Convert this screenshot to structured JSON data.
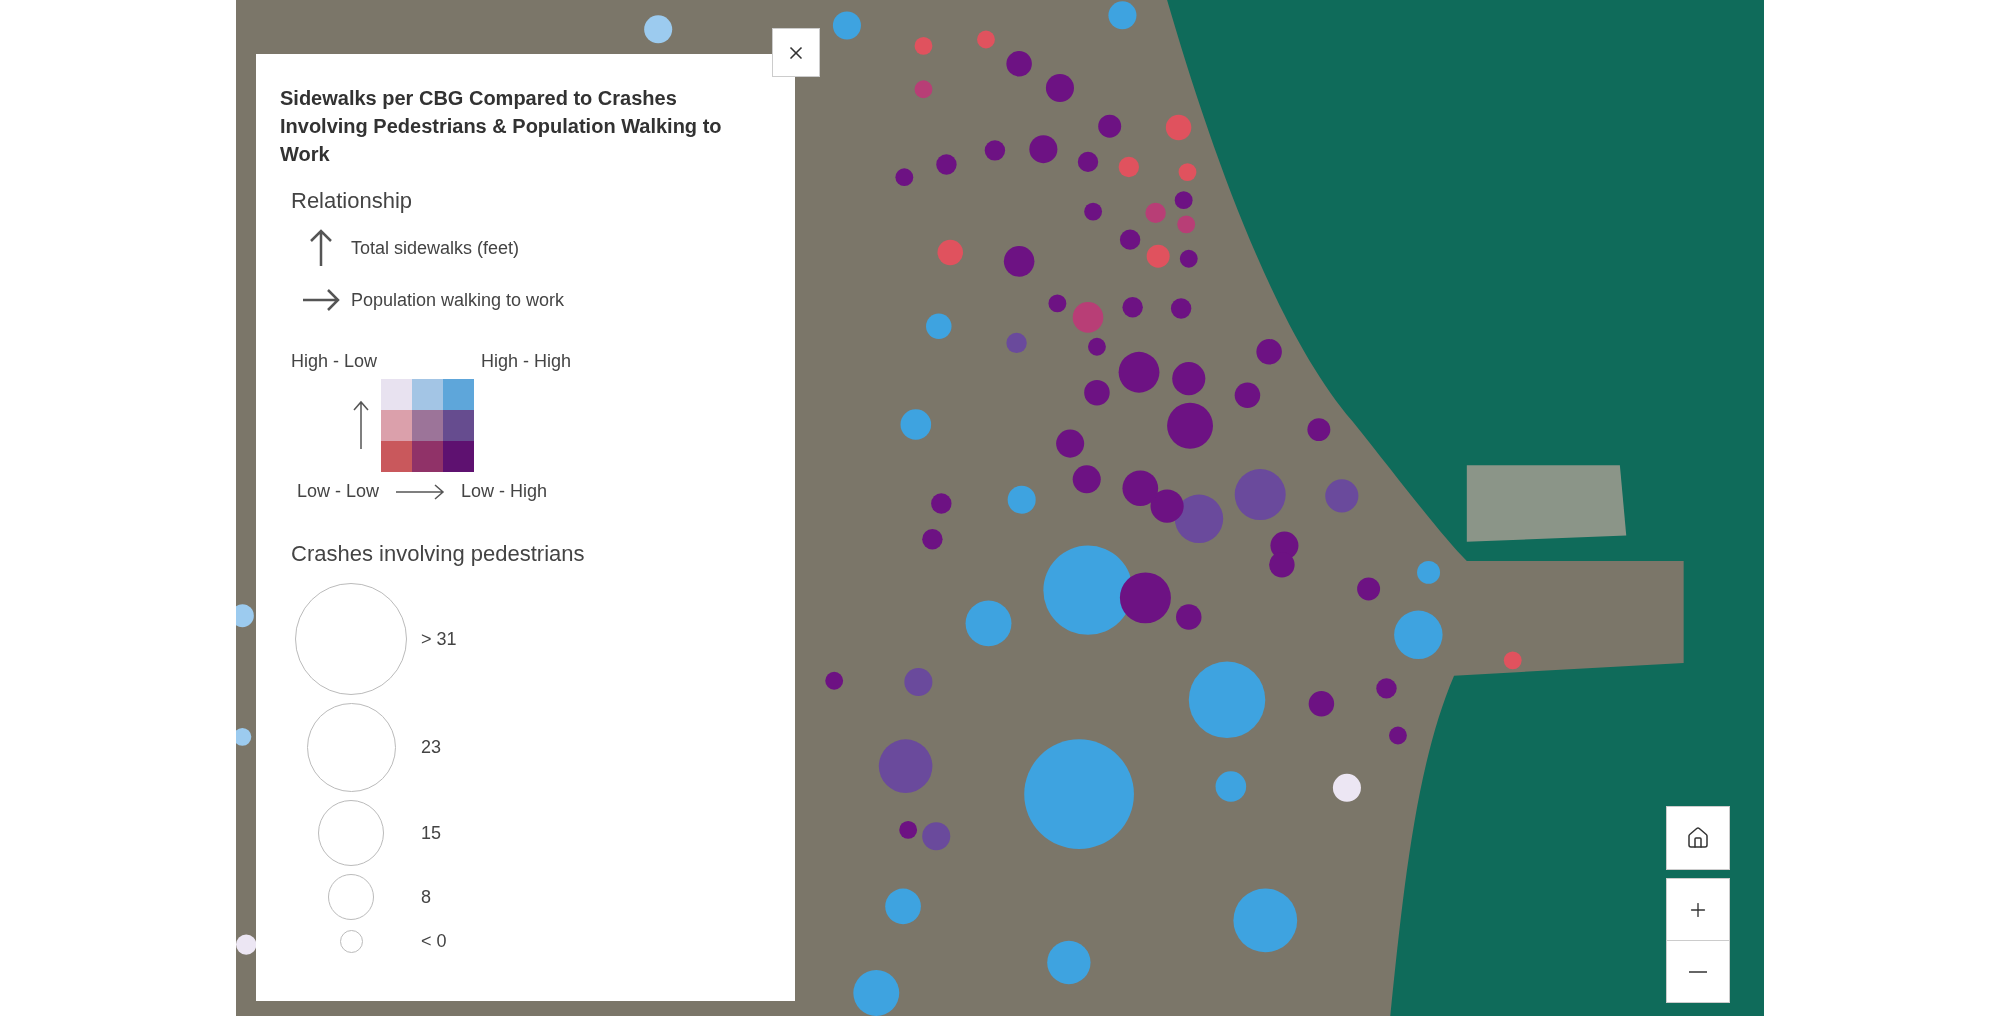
{
  "legend_panel": {
    "title": "Sidewalks per CBG Compared to Crashes Involving Pedestrians & Population Walking to Work",
    "relationship": {
      "title": "Relationship",
      "axes": [
        {
          "kind": "up",
          "label": "Total sidewalks (feet)"
        },
        {
          "kind": "right",
          "label": "Population walking to work"
        }
      ],
      "corner_labels": {
        "top_left": "High - Low",
        "top_right": "High - High",
        "bottom_left": "Low - Low",
        "bottom_right": "Low - High"
      },
      "grid": [
        {
          "color": "#e8e2f0"
        },
        {
          "color": "#a3c5e5"
        },
        {
          "color": "#5ea6da"
        },
        {
          "color": "#dba0ab"
        },
        {
          "color": "#9c7499"
        },
        {
          "color": "#664c8f"
        },
        {
          "color": "#c9585c"
        },
        {
          "color": "#903268"
        },
        {
          "color": "#5e1170"
        }
      ]
    },
    "size_legend": {
      "title": "Crashes involving pedestrians",
      "sizes": [
        {
          "label": "> 31"
        },
        {
          "label": "23"
        },
        {
          "label": "15"
        },
        {
          "label": "8"
        },
        {
          "label": "< 0"
        }
      ]
    }
  }
}
